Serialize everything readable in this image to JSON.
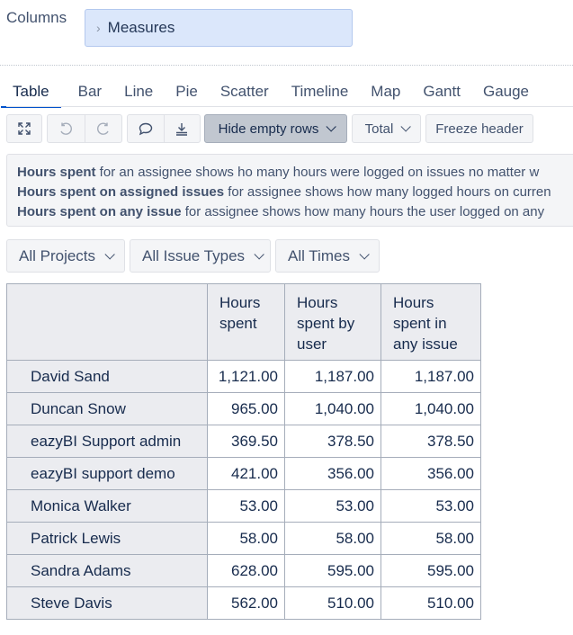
{
  "columns": {
    "label": "Columns",
    "chip": "Measures"
  },
  "tabs": [
    "Table",
    "Bar",
    "Line",
    "Pie",
    "Scatter",
    "Timeline",
    "Map",
    "Gantt",
    "Gauge"
  ],
  "toolbar": {
    "icons": [
      "fullscreen-icon",
      "undo-icon",
      "redo-icon",
      "comment-icon",
      "export-icon"
    ],
    "hide_empty": "Hide empty rows",
    "total": "Total",
    "freeze": "Freeze header"
  },
  "info": [
    {
      "bold": "Hours spent",
      "text": " for an assignee shows ho many hours were logged on issues no matter w"
    },
    {
      "bold": "Hours spent on assigned issues",
      "text": " for assignee shows how many logged hours on curren"
    },
    {
      "bold": "Hours spent on any issue",
      "text": " for assignee shows how many hours the user logged on any"
    }
  ],
  "filters": [
    "All Projects",
    "All Issue Types",
    "All Times"
  ],
  "table": {
    "headers": [
      [
        "Hours",
        "spent"
      ],
      [
        "Hours",
        "spent by",
        "user"
      ],
      [
        "Hours",
        "spent in",
        "any issue"
      ]
    ],
    "rows": [
      {
        "name": "David Sand",
        "values": [
          "1,121.00",
          "1,187.00",
          "1,187.00"
        ]
      },
      {
        "name": "Duncan Snow",
        "values": [
          "965.00",
          "1,040.00",
          "1,040.00"
        ]
      },
      {
        "name": "eazyBI Support admin",
        "values": [
          "369.50",
          "378.50",
          "378.50"
        ]
      },
      {
        "name": "eazyBI support demo",
        "values": [
          "421.00",
          "356.00",
          "356.00"
        ]
      },
      {
        "name": "Monica Walker",
        "values": [
          "53.00",
          "53.00",
          "53.00"
        ]
      },
      {
        "name": "Patrick Lewis",
        "values": [
          "58.00",
          "58.00",
          "58.00"
        ]
      },
      {
        "name": "Sandra Adams",
        "values": [
          "628.00",
          "595.00",
          "595.00"
        ]
      },
      {
        "name": "Steve Davis",
        "values": [
          "562.00",
          "510.00",
          "510.00"
        ]
      }
    ]
  }
}
